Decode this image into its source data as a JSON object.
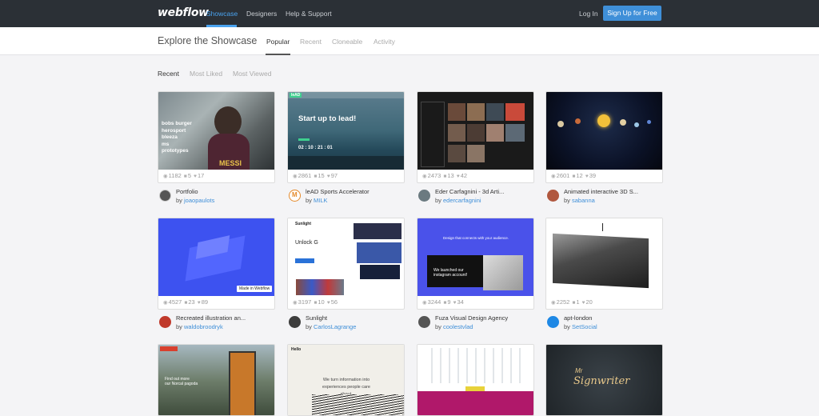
{
  "nav": {
    "logo": "webflow",
    "links": [
      "Showcase",
      "Designers",
      "Help & Support"
    ],
    "login": "Log In",
    "signup": "Sign Up for Free"
  },
  "subnav": {
    "title": "Explore the Showcase",
    "tabs": [
      "Popular",
      "Recent",
      "Cloneable",
      "Activity"
    ]
  },
  "filters": [
    "Recent",
    "Most Liked",
    "Most Viewed"
  ],
  "cards": [
    {
      "title": "Portfolio",
      "author": "joaopaulots",
      "views": "1182",
      "comments": "5",
      "likes": "17",
      "thumb_text": [
        "bobs burger",
        "herosport",
        "bleeza",
        "ms",
        "prototypes",
        "MESSI"
      ]
    },
    {
      "title": "leAD Sports Accelerator",
      "author": "MILK",
      "views": "2861",
      "comments": "15",
      "likes": "97",
      "thumb_text": [
        "leAD",
        "Start up to lead!",
        "02 : 10 : 21 : 01"
      ]
    },
    {
      "title": "Eder Carfagnini - 3d Arti...",
      "author": "edercarfagnini",
      "views": "2473",
      "comments": "13",
      "likes": "42",
      "thumb_text": []
    },
    {
      "title": "Animated interactive 3D S...",
      "author": "sabanna",
      "views": "2601",
      "comments": "12",
      "likes": "39",
      "thumb_text": []
    },
    {
      "title": "Recreated illustration an...",
      "author": "waldobroodryk",
      "views": "4527",
      "comments": "23",
      "likes": "89",
      "thumb_text": [
        "Made in Webflow"
      ]
    },
    {
      "title": "Sunlight",
      "author": "CarlosLagrange",
      "views": "3197",
      "comments": "10",
      "likes": "56",
      "thumb_text": [
        "Sunlight",
        "Unlock G"
      ]
    },
    {
      "title": "Fuza Visual Design Agency",
      "author": "coolestvlad",
      "views": "3244",
      "comments": "9",
      "likes": "34",
      "thumb_text": [
        "Design that connects with your audience.",
        "We launched our instagram account!"
      ]
    },
    {
      "title": "apt-london",
      "author": "SetSocial",
      "views": "2252",
      "comments": "1",
      "likes": "20",
      "thumb_text": []
    },
    {
      "title": "",
      "author": "",
      "views": "",
      "comments": "",
      "likes": "",
      "thumb_text": [
        "Find out more",
        "our Norcal pagoda"
      ]
    },
    {
      "title": "",
      "author": "",
      "views": "",
      "comments": "",
      "likes": "",
      "thumb_text": [
        "Hello",
        "We turn information into",
        "experiences people care about."
      ]
    },
    {
      "title": "",
      "author": "",
      "views": "",
      "comments": "",
      "likes": "",
      "thumb_text": []
    },
    {
      "title": "",
      "author": "",
      "views": "",
      "comments": "",
      "likes": "",
      "thumb_text": [
        "Mr",
        "Signwriter"
      ]
    }
  ],
  "by_label": "by",
  "icons": {
    "views": "eye-icon",
    "comments": "comment-icon",
    "likes": "heart-icon"
  },
  "colors": {
    "topbar": "#2b3036",
    "accent": "#4aa3ef",
    "signup": "#3f8fd8",
    "link": "#3f8fd8"
  }
}
